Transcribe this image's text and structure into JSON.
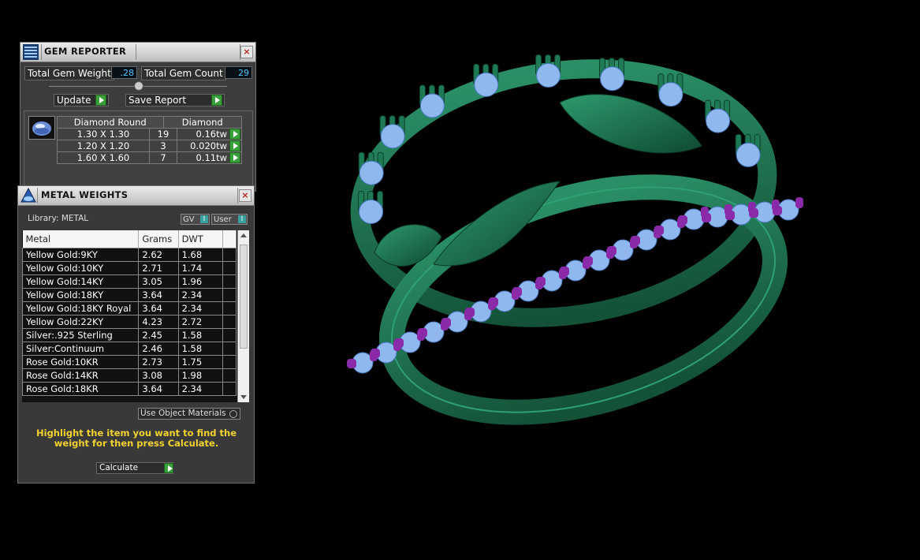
{
  "gem_reporter": {
    "title": "GEM REPORTER",
    "close_icon": "close-icon",
    "total_gem_weight_label": "Total Gem Weight",
    "total_gem_weight_value": ".28",
    "total_gem_count_label": "Total Gem Count",
    "total_gem_count_value": "29",
    "update_label": "Update",
    "save_report_label": "Save Report",
    "gem_table": {
      "headers": [
        "Diamond Round",
        "Diamond"
      ],
      "rows": [
        {
          "size": "1.30 X 1.30",
          "count": "19",
          "weight": "0.16tw"
        },
        {
          "size": "1.20 X 1.20",
          "count": "3",
          "weight": "0.020tw"
        },
        {
          "size": "1.60 X 1.60",
          "count": "7",
          "weight": "0.11tw"
        }
      ]
    }
  },
  "metal_weights": {
    "title": "METAL WEIGHTS",
    "library_label": "Library: METAL",
    "gv_label": "GV",
    "user_label": "User",
    "columns": [
      "Metal",
      "Grams",
      "DWT"
    ],
    "rows": [
      {
        "metal": "Yellow Gold:9KY",
        "grams": "2.62",
        "dwt": "1.68"
      },
      {
        "metal": "Yellow Gold:10KY",
        "grams": "2.71",
        "dwt": "1.74"
      },
      {
        "metal": "Yellow Gold:14KY",
        "grams": "3.05",
        "dwt": "1.96"
      },
      {
        "metal": "Yellow Gold:18KY",
        "grams": "3.64",
        "dwt": "2.34"
      },
      {
        "metal": "Yellow Gold:18KY Royal",
        "grams": "3.64",
        "dwt": "2.34"
      },
      {
        "metal": "Yellow Gold:22KY",
        "grams": "4.23",
        "dwt": "2.72"
      },
      {
        "metal": "Silver:.925 Sterling",
        "grams": "2.45",
        "dwt": "1.58"
      },
      {
        "metal": "Silver:Continuum",
        "grams": "2.46",
        "dwt": "1.58"
      },
      {
        "metal": "Rose Gold:10KR",
        "grams": "2.73",
        "dwt": "1.75"
      },
      {
        "metal": "Rose Gold:14KR",
        "grams": "3.08",
        "dwt": "1.98"
      },
      {
        "metal": "Rose Gold:18KR",
        "grams": "3.64",
        "dwt": "2.34"
      }
    ],
    "use_object_materials_label": "Use Object Materials",
    "instruction": "Highlight the item you want to find the weight for then press Calculate.",
    "calculate_label": "Calculate"
  },
  "colors": {
    "metal_green": "#1f7a56",
    "gem_blue": "#8fb8ee",
    "prong_purple": "#8a2aa8",
    "instruction_yellow": "#f2d22e"
  }
}
